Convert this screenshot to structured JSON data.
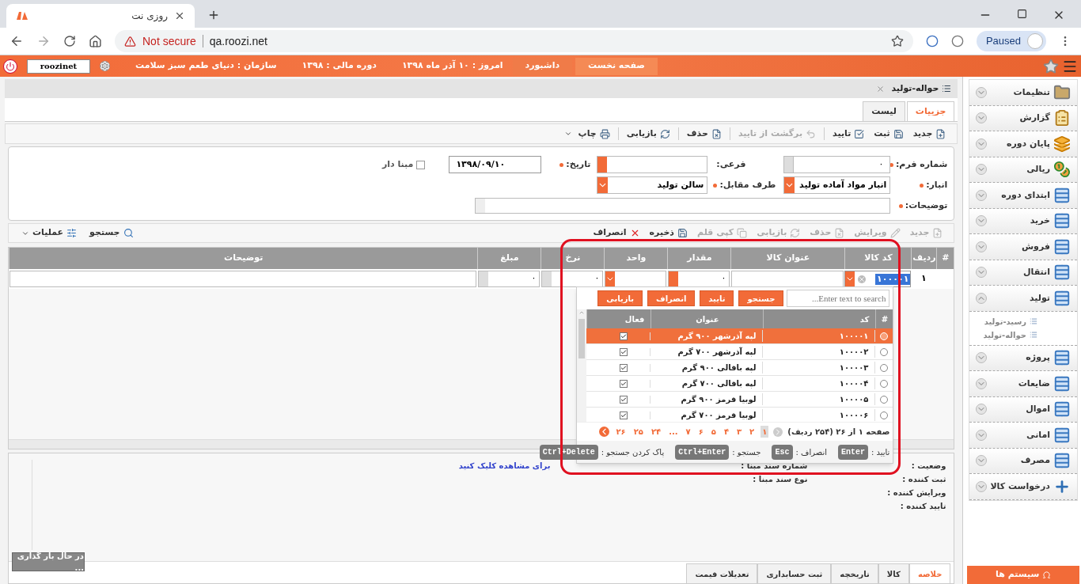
{
  "browser": {
    "tab_title": "روزی نت",
    "url_warning": "Not secure",
    "url": "qa.roozi.net",
    "profile_status": "Paused"
  },
  "header": {
    "buttons": [
      {
        "label": "صفحه نخست",
        "selected": true
      },
      {
        "label": "داشبورد",
        "selected": false
      }
    ],
    "info": [
      "امروز : ۱۰ آذر ماه ۱۳۹۸",
      "دوره مالی : ۱۳۹۸",
      "سازمان : دنیای طعم سبز سلامت"
    ],
    "user": "roozinet"
  },
  "page_tab": "حواله-تولید",
  "tabs": [
    {
      "label": "جزییات",
      "selected": true
    },
    {
      "label": "لیست",
      "selected": false
    }
  ],
  "toolbar": [
    {
      "label": "جدید",
      "kind": "new",
      "disabled": false
    },
    {
      "label": "ثبت",
      "kind": "save",
      "disabled": false
    },
    {
      "label": "تایید",
      "kind": "approve",
      "disabled": false
    },
    {
      "label": "برگشت از تایید",
      "kind": "unapprove",
      "disabled": true
    },
    {
      "label": "حذف",
      "kind": "delete",
      "disabled": false
    },
    {
      "label": "بازیابی",
      "kind": "reload",
      "disabled": false
    },
    {
      "label": "چاپ",
      "kind": "print",
      "disabled": false
    }
  ],
  "form": {
    "number": {
      "label": "شماره فرم:",
      "value": "۰",
      "required": true
    },
    "sub": {
      "label": "فرعی:"
    },
    "date": {
      "label": "تاریخ:",
      "value": "۱۳۹۸/۰۹/۱۰",
      "required": true
    },
    "based": {
      "label": "مبنا دار",
      "checked": false
    },
    "warehouse": {
      "label": "انبار:",
      "value": "انبار مواد آماده تولید",
      "required": true
    },
    "counterpart": {
      "label": "طرف مقابل:",
      "value": "سالن تولید",
      "required": true
    },
    "notes": {
      "label": "توضیحات:",
      "required": true
    }
  },
  "grid_toolbar": [
    {
      "label": "جدید",
      "kind": "new",
      "disabled": true
    },
    {
      "label": "ویرایش",
      "kind": "edit",
      "disabled": true
    },
    {
      "label": "حذف",
      "kind": "delete",
      "disabled": true
    },
    {
      "label": "بازیابی",
      "kind": "reload",
      "disabled": true
    },
    {
      "label": "کپی قلم",
      "kind": "copy",
      "disabled": true
    },
    {
      "label": "ذخیره",
      "kind": "save",
      "disabled": false
    },
    {
      "label": "انصراف",
      "kind": "cancel",
      "disabled": false
    }
  ],
  "grid_actions": [
    {
      "label": "جستجو",
      "kind": "search"
    },
    {
      "label": "عملیات",
      "kind": "menu"
    }
  ],
  "grid": {
    "columns": [
      "#",
      "ردیف",
      "کد کالا",
      "عنوان کالا",
      "مقدار",
      "واحد",
      "نرخ",
      "مبلغ",
      "توضیحات"
    ],
    "row": {
      "number": "۱",
      "code": "۱۰۰۰۰۱",
      "code_highlighted": true,
      "quantity": "۰",
      "rate": "۰",
      "amount": "۰"
    }
  },
  "lookup": {
    "search_placeholder": "Enter text to search...",
    "buttons": [
      "جستجو",
      "تایید",
      "انصراف",
      "بازیابی"
    ],
    "columns": [
      "#",
      "کد",
      "عنوان",
      "فعال"
    ],
    "rows": [
      {
        "code": "۱۰۰۰۰۱",
        "title": "لپه آذرشهر ۹۰۰ گرم",
        "active": true,
        "selected": true
      },
      {
        "code": "۱۰۰۰۰۲",
        "title": "لپه آذرشهر ۷۰۰ گرم",
        "active": true,
        "selected": false
      },
      {
        "code": "۱۰۰۰۰۳",
        "title": "لپه باقالی ۹۰۰ گرم",
        "active": true,
        "selected": false
      },
      {
        "code": "۱۰۰۰۰۴",
        "title": "لپه باقالی ۷۰۰ گرم",
        "active": true,
        "selected": false
      },
      {
        "code": "۱۰۰۰۰۵",
        "title": "لوبیا قرمز ۹۰۰ گرم",
        "active": true,
        "selected": false
      },
      {
        "code": "۱۰۰۰۰۶",
        "title": "لوبیا قرمز ۷۰۰ گرم",
        "active": true,
        "selected": false
      }
    ],
    "pager_text": "صفحه ۱ از ۲۶ (۲۵۴ ردیف)",
    "pages": [
      {
        "label": "۱",
        "selected": true
      },
      {
        "label": "۲",
        "selected": false
      },
      {
        "label": "۳",
        "selected": false
      },
      {
        "label": "۴",
        "selected": false
      },
      {
        "label": "۵",
        "selected": false
      },
      {
        "label": "۶",
        "selected": false
      },
      {
        "label": "۷",
        "selected": false
      },
      {
        "label": "...",
        "selected": false
      },
      {
        "label": "۲۴",
        "selected": false
      },
      {
        "label": "۲۵",
        "selected": false
      },
      {
        "label": "۲۶",
        "selected": false
      }
    ],
    "shortcuts": [
      {
        "label": "تایید :",
        "key": "Enter"
      },
      {
        "label": "انصراف :",
        "key": "Esc"
      },
      {
        "label": "جستجو :",
        "key": "Ctrl+Enter"
      },
      {
        "label": "پاک کردن جستجو :",
        "key": "Ctrl+Delete"
      }
    ]
  },
  "summary": {
    "labels": [
      "وضعیت :",
      "ثبت کننده :",
      "ویرایش کننده :",
      "تایید کننده :"
    ],
    "base_number": "شماره سند مبنا :",
    "base_link": "برای مشاهده کلیک کنید",
    "base_type": "نوع سند مبنا :",
    "loading": "در حال بار گذاری ..."
  },
  "bottom_tabs": [
    {
      "label": "خلاصه",
      "selected": true
    },
    {
      "label": "کالا",
      "selected": false
    },
    {
      "label": "تاریخچه",
      "selected": false
    },
    {
      "label": "ثبت حسابداری",
      "selected": false
    },
    {
      "label": "تعدیلات قیمت",
      "selected": false
    }
  ],
  "sidebar": {
    "items": [
      {
        "label": "تنظیمات",
        "kind": "folder",
        "expanded": false
      },
      {
        "label": "گزارش",
        "kind": "clipboard",
        "expanded": false
      },
      {
        "label": "پایان دوره",
        "kind": "stack",
        "expanded": false
      },
      {
        "label": "ریالی",
        "kind": "coins",
        "expanded": false
      },
      {
        "label": "ابتدای دوره",
        "kind": "table",
        "expanded": false
      },
      {
        "label": "خرید",
        "kind": "table",
        "expanded": false
      },
      {
        "label": "فروش",
        "kind": "table",
        "expanded": false
      },
      {
        "label": "انتقال",
        "kind": "table",
        "expanded": false
      },
      {
        "label": "تولید",
        "kind": "table",
        "expanded": true,
        "children": [
          {
            "label": "رسید-تولید"
          },
          {
            "label": "حواله-تولید"
          }
        ]
      },
      {
        "label": "پروژه",
        "kind": "table",
        "expanded": false
      },
      {
        "label": "ضایعات",
        "kind": "table",
        "expanded": false
      },
      {
        "label": "اموال",
        "kind": "table",
        "expanded": false
      },
      {
        "label": "امانی",
        "kind": "table",
        "expanded": false
      },
      {
        "label": "مصرف",
        "kind": "table",
        "expanded": false
      },
      {
        "label": "درخواست کالا",
        "kind": "plus",
        "expanded": false
      }
    ],
    "footer": "سیستم ها"
  }
}
